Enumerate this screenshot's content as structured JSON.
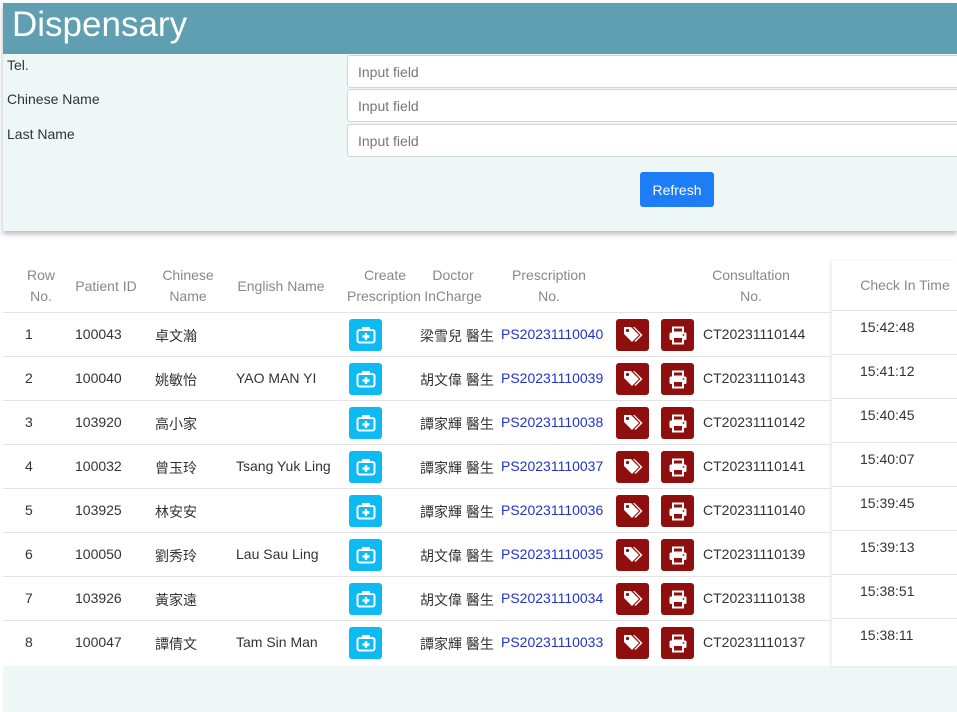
{
  "header": {
    "title": "Dispensary"
  },
  "form": {
    "fields": [
      {
        "label": "Tel.",
        "placeholder": "Input field"
      },
      {
        "label": "Chinese Name",
        "placeholder": "Input field"
      },
      {
        "label": "Last Name",
        "placeholder": "Input field"
      }
    ],
    "refresh_label": "Refresh"
  },
  "table": {
    "headers": {
      "row_no": [
        "Row",
        "No."
      ],
      "patient_id": "Patient ID",
      "chinese_name": [
        "Chinese",
        "Name"
      ],
      "english_name": "English Name",
      "create_prescription": [
        "Create",
        "Prescription"
      ],
      "doctor": [
        "Doctor",
        "InCharge"
      ],
      "prescription_no": [
        "Prescription",
        "No."
      ],
      "consultation_no": [
        "Consultation",
        "No."
      ],
      "check_in_time": "Check In Time"
    },
    "rows": [
      {
        "row_no": "1",
        "patient_id": "100043",
        "chinese_name": "卓文瀚",
        "english_name": "",
        "doctor": "梁雪兒 醫生",
        "prescription_no": "PS20231110040",
        "consultation_no": "CT20231110144",
        "check_in_time": "15:42:48"
      },
      {
        "row_no": "2",
        "patient_id": "100040",
        "chinese_name": "姚敏怡",
        "english_name": "YAO MAN YI",
        "doctor": "胡文偉 醫生",
        "prescription_no": "PS20231110039",
        "consultation_no": "CT20231110143",
        "check_in_time": "15:41:12"
      },
      {
        "row_no": "3",
        "patient_id": "103920",
        "chinese_name": "高小家",
        "english_name": "",
        "doctor": "譚家輝 醫生",
        "prescription_no": "PS20231110038",
        "consultation_no": "CT20231110142",
        "check_in_time": "15:40:45"
      },
      {
        "row_no": "4",
        "patient_id": "100032",
        "chinese_name": "曾玉玲",
        "english_name": "Tsang Yuk Ling",
        "doctor": "譚家輝 醫生",
        "prescription_no": "PS20231110037",
        "consultation_no": "CT20231110141",
        "check_in_time": "15:40:07"
      },
      {
        "row_no": "5",
        "patient_id": "103925",
        "chinese_name": "林安安",
        "english_name": "",
        "doctor": "譚家輝 醫生",
        "prescription_no": "PS20231110036",
        "consultation_no": "CT20231110140",
        "check_in_time": "15:39:45"
      },
      {
        "row_no": "6",
        "patient_id": "100050",
        "chinese_name": "劉秀玲",
        "english_name": "Lau Sau Ling",
        "doctor": "胡文偉 醫生",
        "prescription_no": "PS20231110035",
        "consultation_no": "CT20231110139",
        "check_in_time": "15:39:13"
      },
      {
        "row_no": "7",
        "patient_id": "103926",
        "chinese_name": "黃家遠",
        "english_name": "",
        "doctor": "胡文偉 醫生",
        "prescription_no": "PS20231110034",
        "consultation_no": "CT20231110138",
        "check_in_time": "15:38:51"
      },
      {
        "row_no": "8",
        "patient_id": "100047",
        "chinese_name": "譚倩文",
        "english_name": "Tam Sin Man",
        "doctor": "譚家輝 醫生",
        "prescription_no": "PS20231110033",
        "consultation_no": "CT20231110137",
        "check_in_time": "15:38:11"
      }
    ],
    "row_icons": {
      "create": "medical-kit-icon",
      "label": "tags-icon",
      "print": "printer-icon"
    }
  },
  "colors": {
    "header_bg": "#5f9fb1",
    "panel_bg": "#eef6f6",
    "refresh_bg": "#1c7df6",
    "create_btn_bg": "#0dbaf2",
    "red_btn_bg": "#8f0e0e",
    "link": "#2033c9"
  }
}
